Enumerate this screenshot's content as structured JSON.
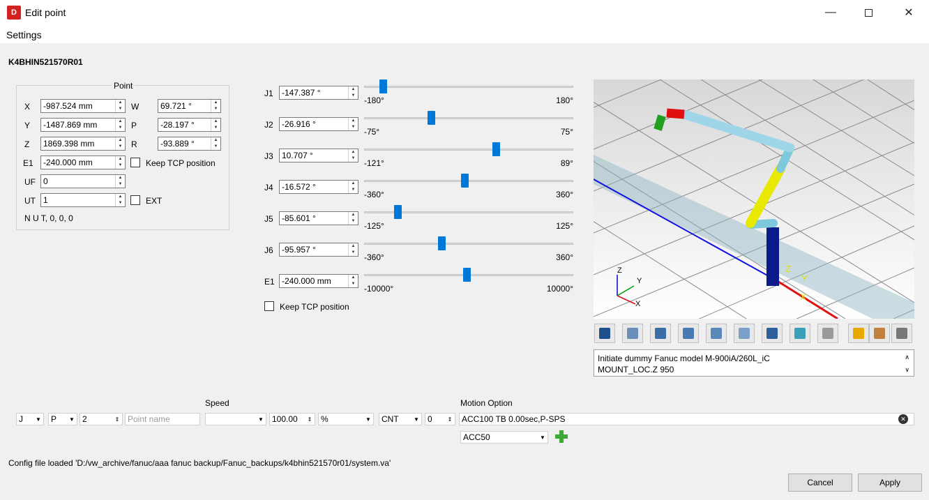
{
  "window": {
    "title": "Edit point",
    "icon_text": "D"
  },
  "menu": {
    "settings": "Settings"
  },
  "robot_name": "K4BHIN521570R01",
  "point_group": {
    "title": "Point",
    "fields": [
      {
        "label": "X",
        "value": "-987.524 mm"
      },
      {
        "label": "Y",
        "value": "-1487.869 mm"
      },
      {
        "label": "Z",
        "value": "1869.398 mm"
      },
      {
        "label": "E1",
        "value": "-240.000 mm"
      },
      {
        "label": "UF",
        "value": "0"
      },
      {
        "label": "UT",
        "value": "1"
      }
    ],
    "orient": [
      {
        "label": "W",
        "value": "69.721 °"
      },
      {
        "label": "P",
        "value": "-28.197 °"
      },
      {
        "label": "R",
        "value": "-93.889 °"
      }
    ],
    "keep_tcp_label": "Keep TCP position",
    "ext_label": "EXT",
    "config": "N U T, 0, 0, 0"
  },
  "joints": [
    {
      "label": "J1",
      "value": "-147.387 °",
      "min": "-180°",
      "max": "180°",
      "fraction": 0.09
    },
    {
      "label": "J2",
      "value": "-26.916 °",
      "min": "-75°",
      "max": "75°",
      "fraction": 0.32
    },
    {
      "label": "J3",
      "value": "10.707 °",
      "min": "-121°",
      "max": "89°",
      "fraction": 0.63
    },
    {
      "label": "J4",
      "value": "-16.572 °",
      "min": "-360°",
      "max": "360°",
      "fraction": 0.48
    },
    {
      "label": "J5",
      "value": "-85.601 °",
      "min": "-125°",
      "max": "125°",
      "fraction": 0.16
    },
    {
      "label": "J6",
      "value": "-95.957 °",
      "min": "-360°",
      "max": "360°",
      "fraction": 0.37
    },
    {
      "label": "E1",
      "value": "-240.000 mm",
      "min": "-10000°",
      "max": "10000°",
      "fraction": 0.49
    }
  ],
  "joint_keep_tcp_label": "Keep TCP position",
  "viewport": {
    "axis_labels": [
      "Z",
      "Y",
      "X"
    ],
    "frame_labels": [
      "Z",
      "Y",
      "X"
    ]
  },
  "toolbar_icons": [
    "view-iso-icon",
    "view-top-icon",
    "view-front-icon",
    "view-left-icon",
    "view-right-icon",
    "view-back-icon",
    "view-bottom-icon",
    "fit-all-icon",
    "robot-icon",
    "ruler-icon",
    "tool-icon",
    "camera-icon"
  ],
  "log": {
    "line1": "Initiate dummy Fanuc model M-900iA/260L_iC",
    "line2": "MOUNT_LOC.Z 950"
  },
  "motion": {
    "type": "J",
    "pos_type": "P",
    "number": "2",
    "name_placeholder": "Point name",
    "speed_label": "Speed",
    "speed_combo": "",
    "speed_value": "100.00",
    "speed_unit": "%",
    "term_type": "CNT",
    "term_value": "0",
    "motion_option_label": "Motion Option",
    "motion_option_value": "ACC100 TB 0.00sec,P-SPS",
    "option_select": "ACC50"
  },
  "status": "Config file loaded 'D:/vw_archive/fanuc/aaa fanuc backup/Fanuc_backups/k4bhin521570r01/system.va'",
  "buttons": {
    "cancel": "Cancel",
    "apply": "Apply"
  },
  "colors": {
    "accent": "#0078d7",
    "slider": "#0078d7",
    "add": "#3aa935"
  }
}
